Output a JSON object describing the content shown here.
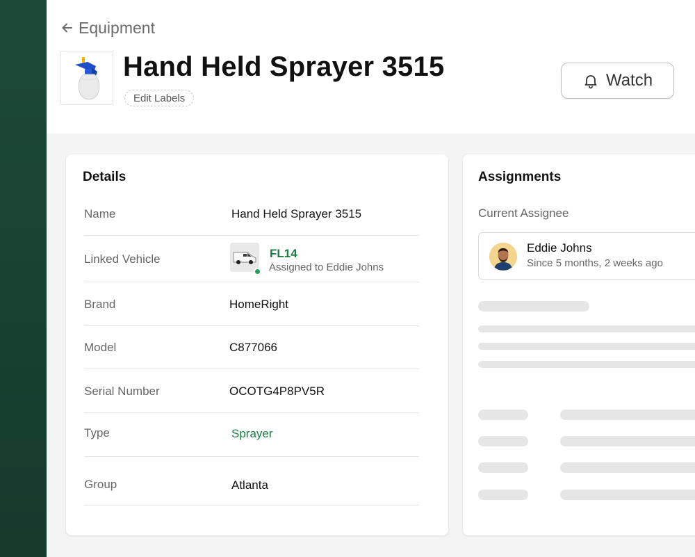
{
  "breadcrumb": {
    "label": "Equipment"
  },
  "asset": {
    "title": "Hand Held Sprayer 3515",
    "edit_labels": "Edit Labels"
  },
  "actions": {
    "watch_label": "Watch"
  },
  "details": {
    "title": "Details",
    "rows": {
      "name": {
        "label": "Name",
        "value": "Hand Held Sprayer 3515"
      },
      "linked_vehicle": {
        "label": "Linked Vehicle",
        "vehicle_name": "FL14",
        "vehicle_sub": "Assigned to Eddie Johns",
        "status": "active"
      },
      "brand": {
        "label": "Brand",
        "value": "HomeRight"
      },
      "model": {
        "label": "Model",
        "value": "C877066"
      },
      "serial": {
        "label": "Serial Number",
        "value": "OCOTG4P8PV5R"
      },
      "type": {
        "label": "Type",
        "value": "Sprayer"
      },
      "group": {
        "label": "Group",
        "value": "Atlanta"
      }
    }
  },
  "assignments": {
    "title": "Assignments",
    "current_label": "Current Assignee",
    "assignee": {
      "name": "Eddie Johns",
      "since": "Since 5 months, 2 weeks ago"
    }
  },
  "colors": {
    "sidebar": "#1d4a38",
    "accent_green": "#1d7a44",
    "status_green": "#1fa35b"
  },
  "icons": {
    "back": "arrow-left-icon",
    "watch": "bell-icon",
    "asset_thumbnail": "sprayer-image",
    "vehicle_thumbnail": "van-image"
  }
}
